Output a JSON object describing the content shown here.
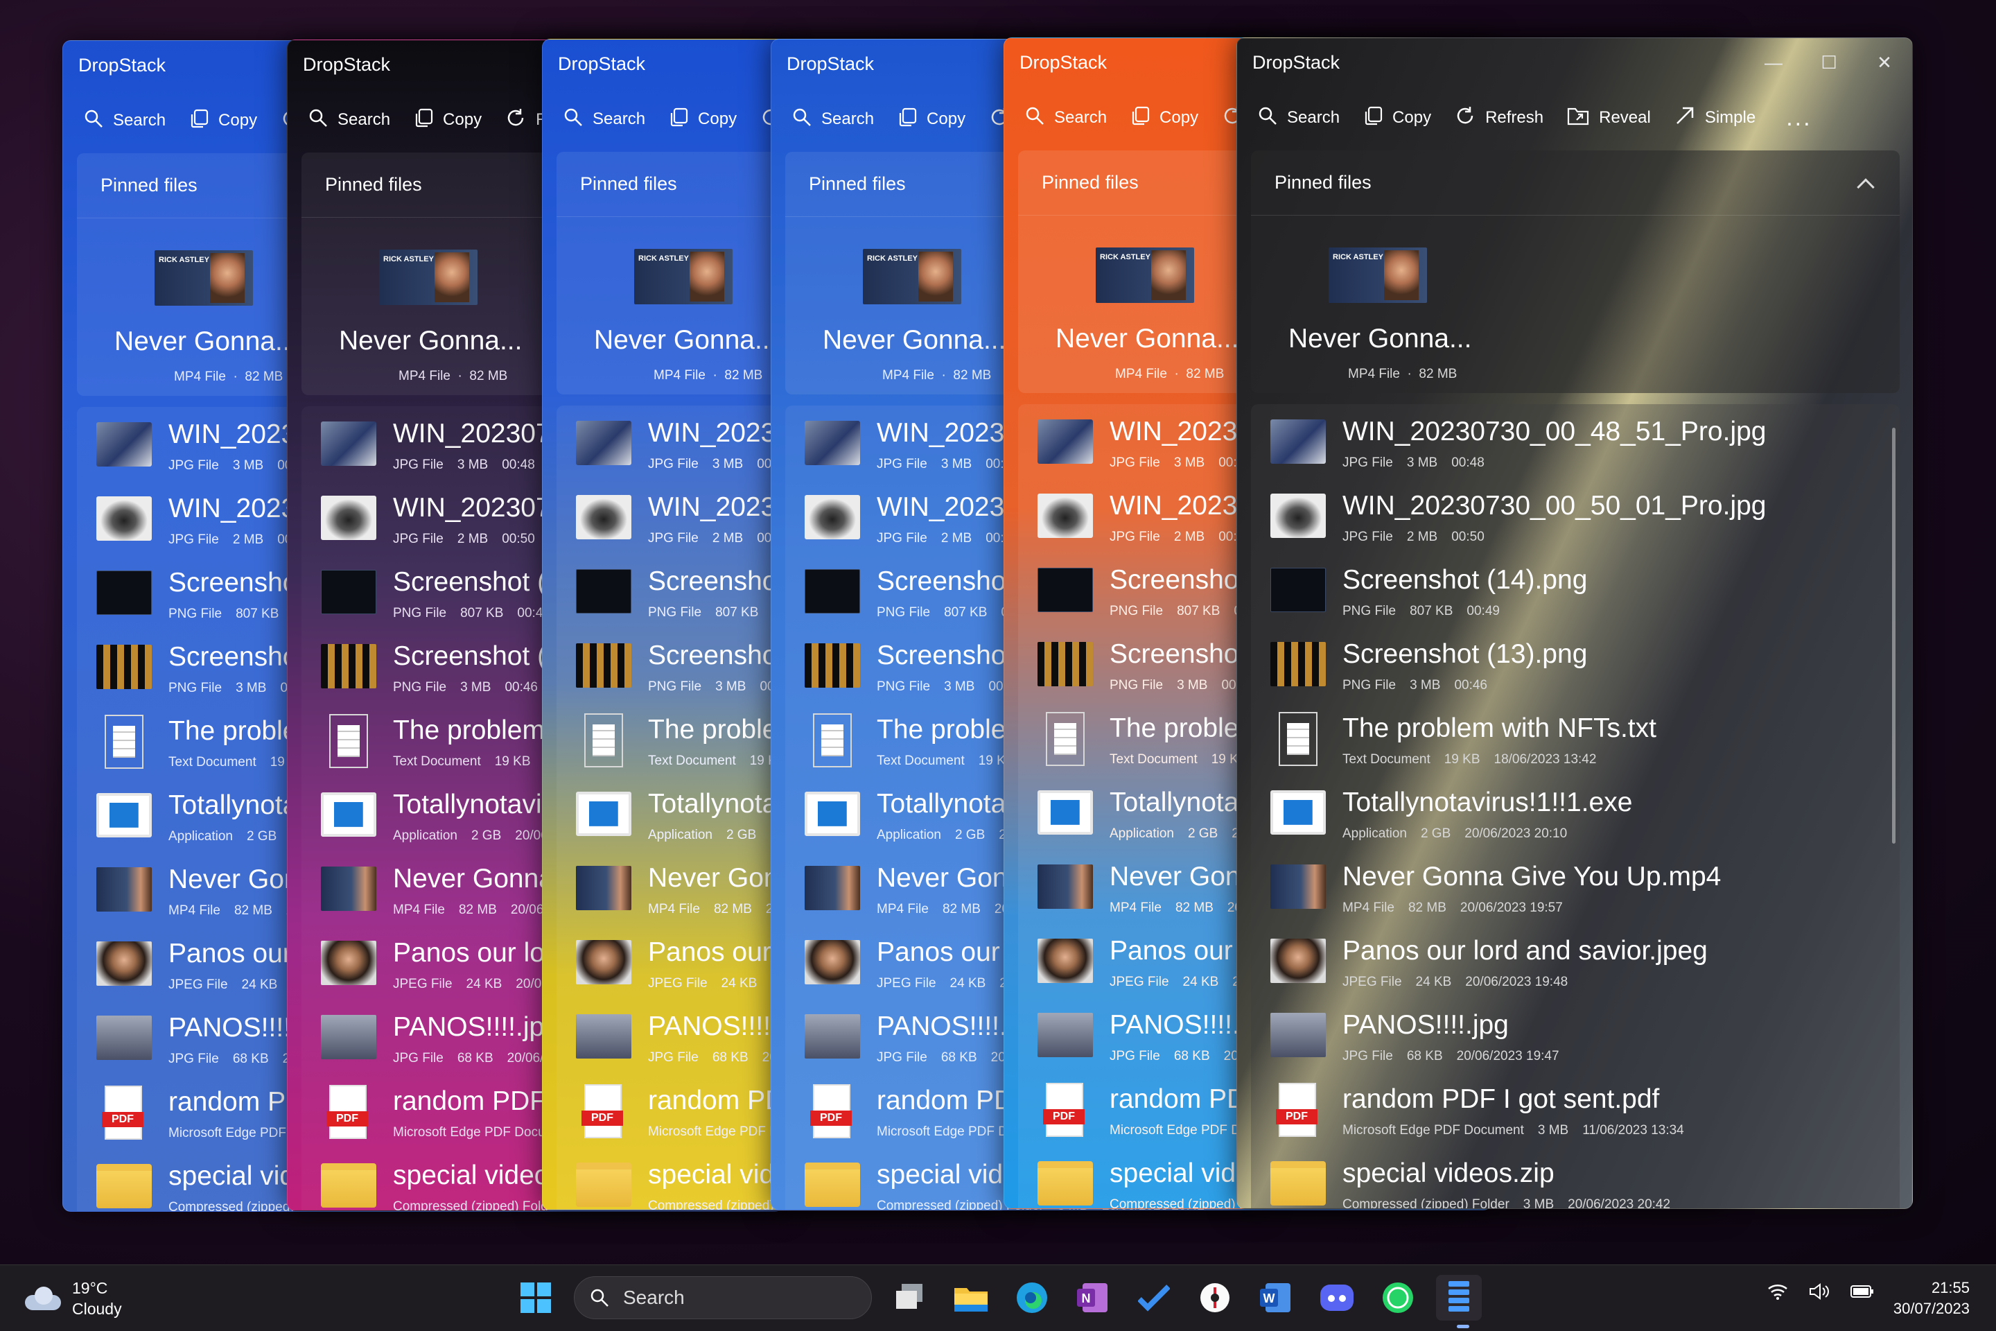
{
  "windows": [
    {
      "title": "DropStack",
      "theme": "blue"
    },
    {
      "title": "DropStack",
      "theme": "purple"
    },
    {
      "title": "DropStack",
      "theme": "yellow"
    },
    {
      "title": "DropStack",
      "theme": "lightblue"
    },
    {
      "title": "DropStack",
      "theme": "orange"
    },
    {
      "title": "DropStack",
      "theme": "dark"
    }
  ],
  "window": {
    "title": "DropStack",
    "commands": {
      "search": "Search",
      "copy": "Copy",
      "refresh": "Refresh",
      "reveal": "Reveal",
      "simple": "Simple",
      "more": "..."
    }
  },
  "pinned": {
    "header": "Pinned files",
    "item": {
      "name": "Never Gonna...",
      "type": "MP4 File",
      "size": "82 MB",
      "thumb_text": "RICK ASTLEY"
    }
  },
  "files": [
    {
      "name": "WIN_20230730_00_48_51_Pro.jpg",
      "type": "JPG File",
      "size": "3 MB",
      "date": "00:48",
      "icon": "laptop-photo"
    },
    {
      "name": "WIN_20230730_00_50_01_Pro.jpg",
      "type": "JPG File",
      "size": "2 MB",
      "date": "00:50",
      "icon": "dark-object-photo"
    },
    {
      "name": "Screenshot (14).png",
      "type": "PNG File",
      "size": "807 KB",
      "date": "00:49",
      "icon": "screenshot"
    },
    {
      "name": "Screenshot (13).png",
      "type": "PNG File",
      "size": "3 MB",
      "date": "00:46",
      "icon": "screenshot-grid"
    },
    {
      "name": "The problem with NFTs.txt",
      "type": "Text Document",
      "size": "19 KB",
      "date": "18/06/2023 13:42",
      "icon": "text-document"
    },
    {
      "name": "Totallynotavirus!1!!1.exe",
      "type": "Application",
      "size": "2 GB",
      "date": "20/06/2023 20:10",
      "icon": "application"
    },
    {
      "name": "Never Gonna Give You Up.mp4",
      "type": "MP4 File",
      "size": "82 MB",
      "date": "20/06/2023 19:57",
      "icon": "video"
    },
    {
      "name": "Panos our lord and savior.jpeg",
      "type": "JPEG File",
      "size": "24 KB",
      "date": "20/06/2023 19:48",
      "icon": "portrait-photo"
    },
    {
      "name": "PANOS!!!!.jpg",
      "type": "JPG File",
      "size": "68 KB",
      "date": "20/06/2023 19:47",
      "icon": "office-photo"
    },
    {
      "name": "random PDF I got sent.pdf",
      "type": "Microsoft Edge PDF Document",
      "size": "3 MB",
      "date": "11/06/2023 13:34",
      "icon": "pdf"
    },
    {
      "name": "special videos.zip",
      "type": "Compressed (zipped) Folder",
      "size": "3 MB",
      "date": "20/06/2023 20:42",
      "icon": "zip-folder"
    }
  ],
  "taskbar": {
    "weather_temp": "19°C",
    "weather_desc": "Cloudy",
    "search_label": "Search",
    "time": "21:55",
    "date": "30/07/2023"
  },
  "colors": {
    "blue": "#1f4fc4",
    "purple": "#5a2a7a",
    "yellow": "#e8c820",
    "lightblue": "#3a7ae0",
    "orange": "#f05a28",
    "dark": "#202020"
  }
}
